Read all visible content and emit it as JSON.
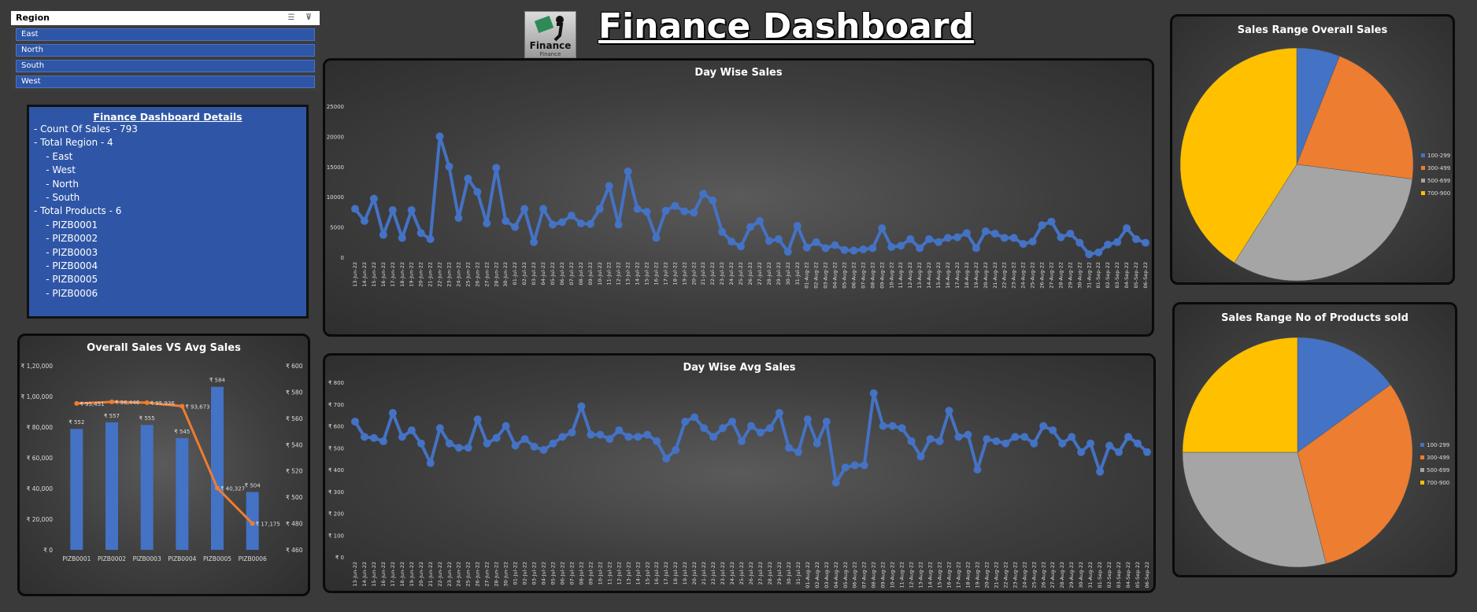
{
  "slicer": {
    "title": "Region",
    "items": [
      "East",
      "North",
      "South",
      "West"
    ]
  },
  "details": {
    "title": "Finance Dashboard Details",
    "lines": [
      "- Count Of Sales - 793",
      "- Total Region - 4",
      "    - East",
      "    - West",
      "    - North",
      "    - South",
      "- Total Products - 6",
      "    - PIZB0001",
      "    - PIZB0002",
      "    - PIZB0003",
      "    - PIZB0004",
      "    - PIZB0005",
      "    - PIZB0006"
    ]
  },
  "header": {
    "title": "Finance Dashboard",
    "logo_text": "Finance",
    "logo_sub": "Finance"
  },
  "colors": {
    "line": "#4472c4",
    "bar": "#4472c4",
    "avg": "#ed7d31",
    "pie": [
      "#4472c4",
      "#ed7d31",
      "#a5a5a5",
      "#ffc000"
    ]
  },
  "chart_data": [
    {
      "id": "overall",
      "type": "bar",
      "title": "Overall Sales VS Avg Sales",
      "categories": [
        "PIZB0001",
        "PIZB0002",
        "PIZB0003",
        "PIZB0004",
        "PIZB0005",
        "PIZB0006"
      ],
      "series": [
        {
          "values": [
            95451,
            96446,
            95936,
            93673,
            40327,
            17175
          ],
          "labels": [
            "₹ 95,451",
            "₹ 96,446",
            "₹ 95,936",
            "₹ 93,673",
            "₹ 40,327",
            "₹ 17,175"
          ]
        },
        {
          "values": [
            552,
            557,
            555,
            545,
            584,
            504
          ],
          "labels": [
            "₹ 552",
            "₹ 557",
            "₹ 555",
            "₹ 545",
            "₹ 584",
            "₹ 504"
          ]
        }
      ],
      "ylim": [
        0,
        120000
      ],
      "y_ticks": [
        "₹ 0",
        "₹ 20,000",
        "₹ 40,000",
        "₹ 60,000",
        "₹ 80,000",
        "₹ 1,00,000",
        "₹ 1,20,000"
      ],
      "y2lim": [
        460,
        600
      ],
      "y2_ticks": [
        "₹ 460",
        "₹ 480",
        "₹ 500",
        "₹ 520",
        "₹ 540",
        "₹ 560",
        "₹ 580",
        "₹ 600"
      ]
    },
    {
      "id": "daywise",
      "type": "line",
      "title": "Day Wise Sales",
      "ylim": [
        0,
        25000
      ],
      "y_ticks": [
        "0",
        "5000",
        "10000",
        "15000",
        "20000",
        "25000"
      ],
      "x": [
        "13-Jun-22",
        "14-Jun-22",
        "15-Jun-22",
        "16-Jun-22",
        "17-Jun-22",
        "18-Jun-22",
        "19-Jun-22",
        "20-Jun-22",
        "21-Jun-22",
        "22-Jun-22",
        "23-Jun-22",
        "24-Jun-22",
        "25-Jun-22",
        "26-Jun-22",
        "27-Jun-22",
        "28-Jun-22",
        "30-Jun-22",
        "01-Jul-22",
        "02-Jul-22",
        "03-Jul-22",
        "04-Jul-22",
        "05-Jul-22",
        "06-Jul-22",
        "07-Jul-22",
        "08-Jul-22",
        "09-Jul-22",
        "10-Jul-22",
        "11-Jul-22",
        "12-Jul-22",
        "13-Jul-22",
        "14-Jul-22",
        "15-Jul-22",
        "16-Jul-22",
        "17-Jul-22",
        "18-Jul-22",
        "19-Jul-22",
        "20-Jul-22",
        "21-Jul-22",
        "22-Jul-22",
        "23-Jul-22",
        "24-Jul-22",
        "25-Jul-22",
        "26-Jul-22",
        "27-Jul-22",
        "28-Jul-22",
        "29-Jul-22",
        "30-Jul-22",
        "31-Jul-22",
        "01-Aug-22",
        "02-Aug-22",
        "03-Aug-22",
        "04-Aug-22",
        "05-Aug-22",
        "06-Aug-22",
        "07-Aug-22",
        "08-Aug-22",
        "09-Aug-22",
        "10-Aug-22",
        "11-Aug-22",
        "12-Aug-22",
        "13-Aug-22",
        "14-Aug-22",
        "15-Aug-22",
        "16-Aug-22",
        "17-Aug-22",
        "18-Aug-22",
        "19-Aug-22",
        "20-Aug-22",
        "21-Aug-22",
        "22-Aug-22",
        "23-Aug-22",
        "24-Aug-22",
        "25-Aug-22",
        "26-Aug-22",
        "27-Aug-22",
        "28-Aug-22",
        "29-Aug-22",
        "30-Aug-22",
        "31-Aug-22",
        "01-Sep-22",
        "02-Sep-22",
        "03-Sep-22",
        "04-Sep-22",
        "05-Sep-22",
        "06-Sep-22"
      ],
      "values": [
        8000,
        6000,
        9700,
        3700,
        7800,
        3200,
        7800,
        4000,
        3000,
        20000,
        15000,
        6500,
        13000,
        10800,
        5600,
        14800,
        6000,
        5000,
        8000,
        2500,
        8000,
        5400,
        5800,
        6900,
        5600,
        5500,
        8000,
        11800,
        5400,
        14200,
        8000,
        7500,
        3200,
        7700,
        8500,
        7600,
        7400,
        10500,
        9400,
        4200,
        2600,
        1800,
        5000,
        6000,
        2700,
        3000,
        900,
        5200,
        1600,
        2500,
        1500,
        2000,
        1200,
        1100,
        1300,
        1500,
        4800,
        1700,
        1900,
        3000,
        1500,
        3000,
        2500,
        3200,
        3300,
        4000,
        1500,
        4300,
        3900,
        3200,
        3200,
        2200,
        2600,
        5300,
        5900,
        3300,
        3900,
        2400,
        500,
        800,
        2100,
        2500,
        4800,
        3000,
        2400
      ]
    },
    {
      "id": "dayavg",
      "type": "line",
      "title": "Day Wise Avg Sales",
      "ylim": [
        0,
        800
      ],
      "y_ticks": [
        "₹ 0",
        "₹ 100",
        "₹ 200",
        "₹ 300",
        "₹ 400",
        "₹ 500",
        "₹ 600",
        "₹ 700",
        "₹ 800"
      ],
      "x": [
        "13-Jun-22",
        "14-Jun-22",
        "15-Jun-22",
        "16-Jun-22",
        "17-Jun-22",
        "18-Jun-22",
        "19-Jun-22",
        "20-Jun-22",
        "21-Jun-22",
        "22-Jun-22",
        "23-Jun-22",
        "24-Jun-22",
        "25-Jun-22",
        "26-Jun-22",
        "27-Jun-22",
        "28-Jun-22",
        "30-Jun-22",
        "01-Jul-22",
        "02-Jul-22",
        "03-Jul-22",
        "04-Jul-22",
        "05-Jul-22",
        "06-Jul-22",
        "07-Jul-22",
        "08-Jul-22",
        "09-Jul-22",
        "10-Jul-22",
        "11-Jul-22",
        "12-Jul-22",
        "13-Jul-22",
        "14-Jul-22",
        "15-Jul-22",
        "16-Jul-22",
        "17-Jul-22",
        "18-Jul-22",
        "19-Jul-22",
        "20-Jul-22",
        "21-Jul-22",
        "22-Jul-22",
        "23-Jul-22",
        "24-Jul-22",
        "25-Jul-22",
        "26-Jul-22",
        "27-Jul-22",
        "28-Jul-22",
        "29-Jul-22",
        "30-Jul-22",
        "31-Jul-22",
        "01-Aug-22",
        "02-Aug-22",
        "03-Aug-22",
        "04-Aug-22",
        "05-Aug-22",
        "06-Aug-22",
        "07-Aug-22",
        "08-Aug-22",
        "09-Aug-22",
        "10-Aug-22",
        "11-Aug-22",
        "12-Aug-22",
        "13-Aug-22",
        "14-Aug-22",
        "15-Aug-22",
        "16-Aug-22",
        "17-Aug-22",
        "18-Aug-22",
        "19-Aug-22",
        "20-Aug-22",
        "21-Aug-22",
        "22-Aug-22",
        "23-Aug-22",
        "24-Aug-22",
        "25-Aug-22",
        "26-Aug-22",
        "27-Aug-22",
        "28-Aug-22",
        "29-Aug-22",
        "30-Aug-22",
        "31-Aug-22",
        "01-Sep-22",
        "02-Sep-22",
        "03-Sep-22",
        "04-Sep-22",
        "05-Sep-22",
        "06-Sep-22"
      ],
      "values": [
        620,
        550,
        545,
        530,
        660,
        550,
        580,
        520,
        430,
        590,
        520,
        500,
        500,
        630,
        520,
        545,
        600,
        510,
        540,
        505,
        490,
        520,
        550,
        570,
        690,
        560,
        560,
        540,
        580,
        550,
        550,
        560,
        530,
        450,
        490,
        620,
        640,
        590,
        550,
        590,
        620,
        530,
        600,
        570,
        590,
        660,
        500,
        480,
        630,
        520,
        620,
        340,
        410,
        420,
        420,
        750,
        600,
        600,
        590,
        530,
        460,
        540,
        530,
        670,
        550,
        560,
        400,
        540,
        530,
        520,
        550,
        550,
        520,
        600,
        580,
        520,
        550,
        480,
        520,
        390,
        510,
        480,
        550,
        520,
        480
      ]
    },
    {
      "id": "pie1",
      "type": "pie",
      "title": "Sales Range Overall Sales",
      "categories": [
        "100-299",
        "300-499",
        "500-699",
        "700-900"
      ],
      "values": [
        6,
        21,
        32,
        41
      ]
    },
    {
      "id": "pie2",
      "type": "pie",
      "title": "Sales Range No of Products sold",
      "categories": [
        "100-299",
        "300-499",
        "500-699",
        "700-900"
      ],
      "values": [
        15,
        31,
        29,
        25
      ]
    }
  ]
}
